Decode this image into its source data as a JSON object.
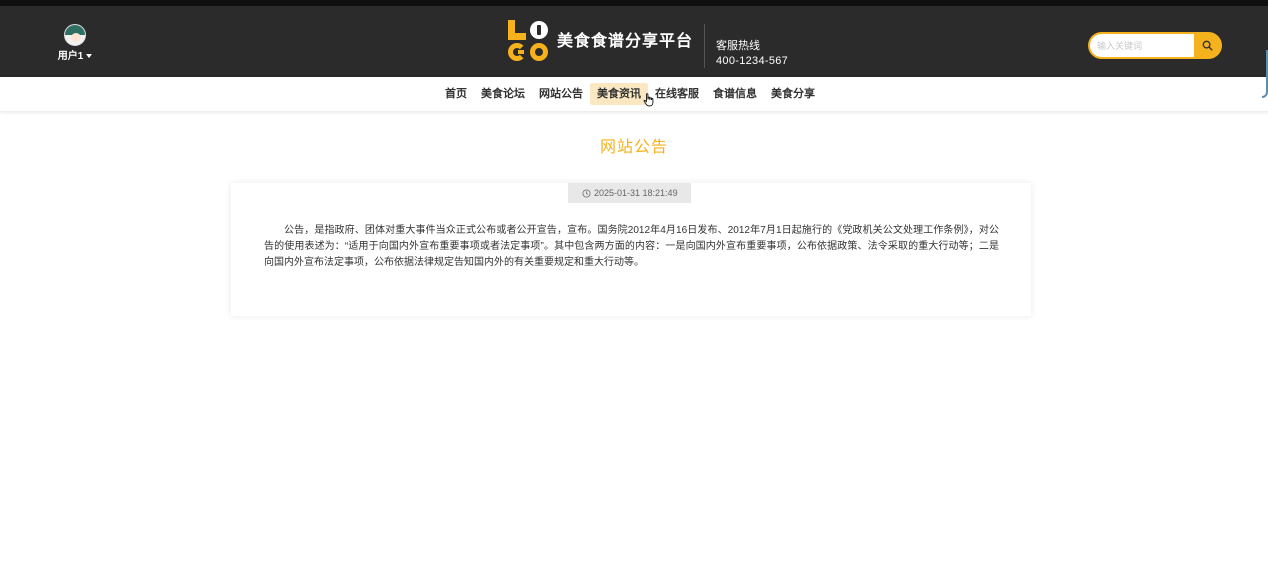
{
  "header": {
    "user_name": "用户1",
    "site_title": "美食食谱分享平台",
    "hotline_label": "客服热线",
    "hotline_number": "400-1234-567",
    "search_placeholder": "输入关键词"
  },
  "nav": {
    "items": [
      {
        "label": "首页"
      },
      {
        "label": "美食论坛"
      },
      {
        "label": "网站公告"
      },
      {
        "label": "美食资讯"
      },
      {
        "label": "在线客服"
      },
      {
        "label": "食谱信息"
      },
      {
        "label": "美食分享"
      }
    ],
    "active_index": 3
  },
  "main": {
    "page_title": "网站公告",
    "timestamp": "2025-01-31 18:21:49",
    "content": "公告，是指政府、团体对重大事件当众正式公布或者公开宣告，宣布。国务院2012年4月16日发布、2012年7月1日起施行的《党政机关公文处理工作条例》，对公告的使用表述为：“适用于向国内外宣布重要事项或者法定事项”。其中包含两方面的内容：一是向国内外宣布重要事项，公布依据政策、法令采取的重大行动等；二是向国内外宣布法定事项，公布依据法律规定告知国内外的有关重要规定和重大行动等。"
  },
  "icons": {
    "avatar": "avatar",
    "user_menu": "chevron-down-icon",
    "search": "search-icon",
    "time": "clock-icon",
    "cursor": "hand-pointer-icon"
  },
  "colors": {
    "accent": "#f5b21c",
    "header_bg": "#2b2b2b",
    "nav_active_bg": "#fbe8c2"
  }
}
